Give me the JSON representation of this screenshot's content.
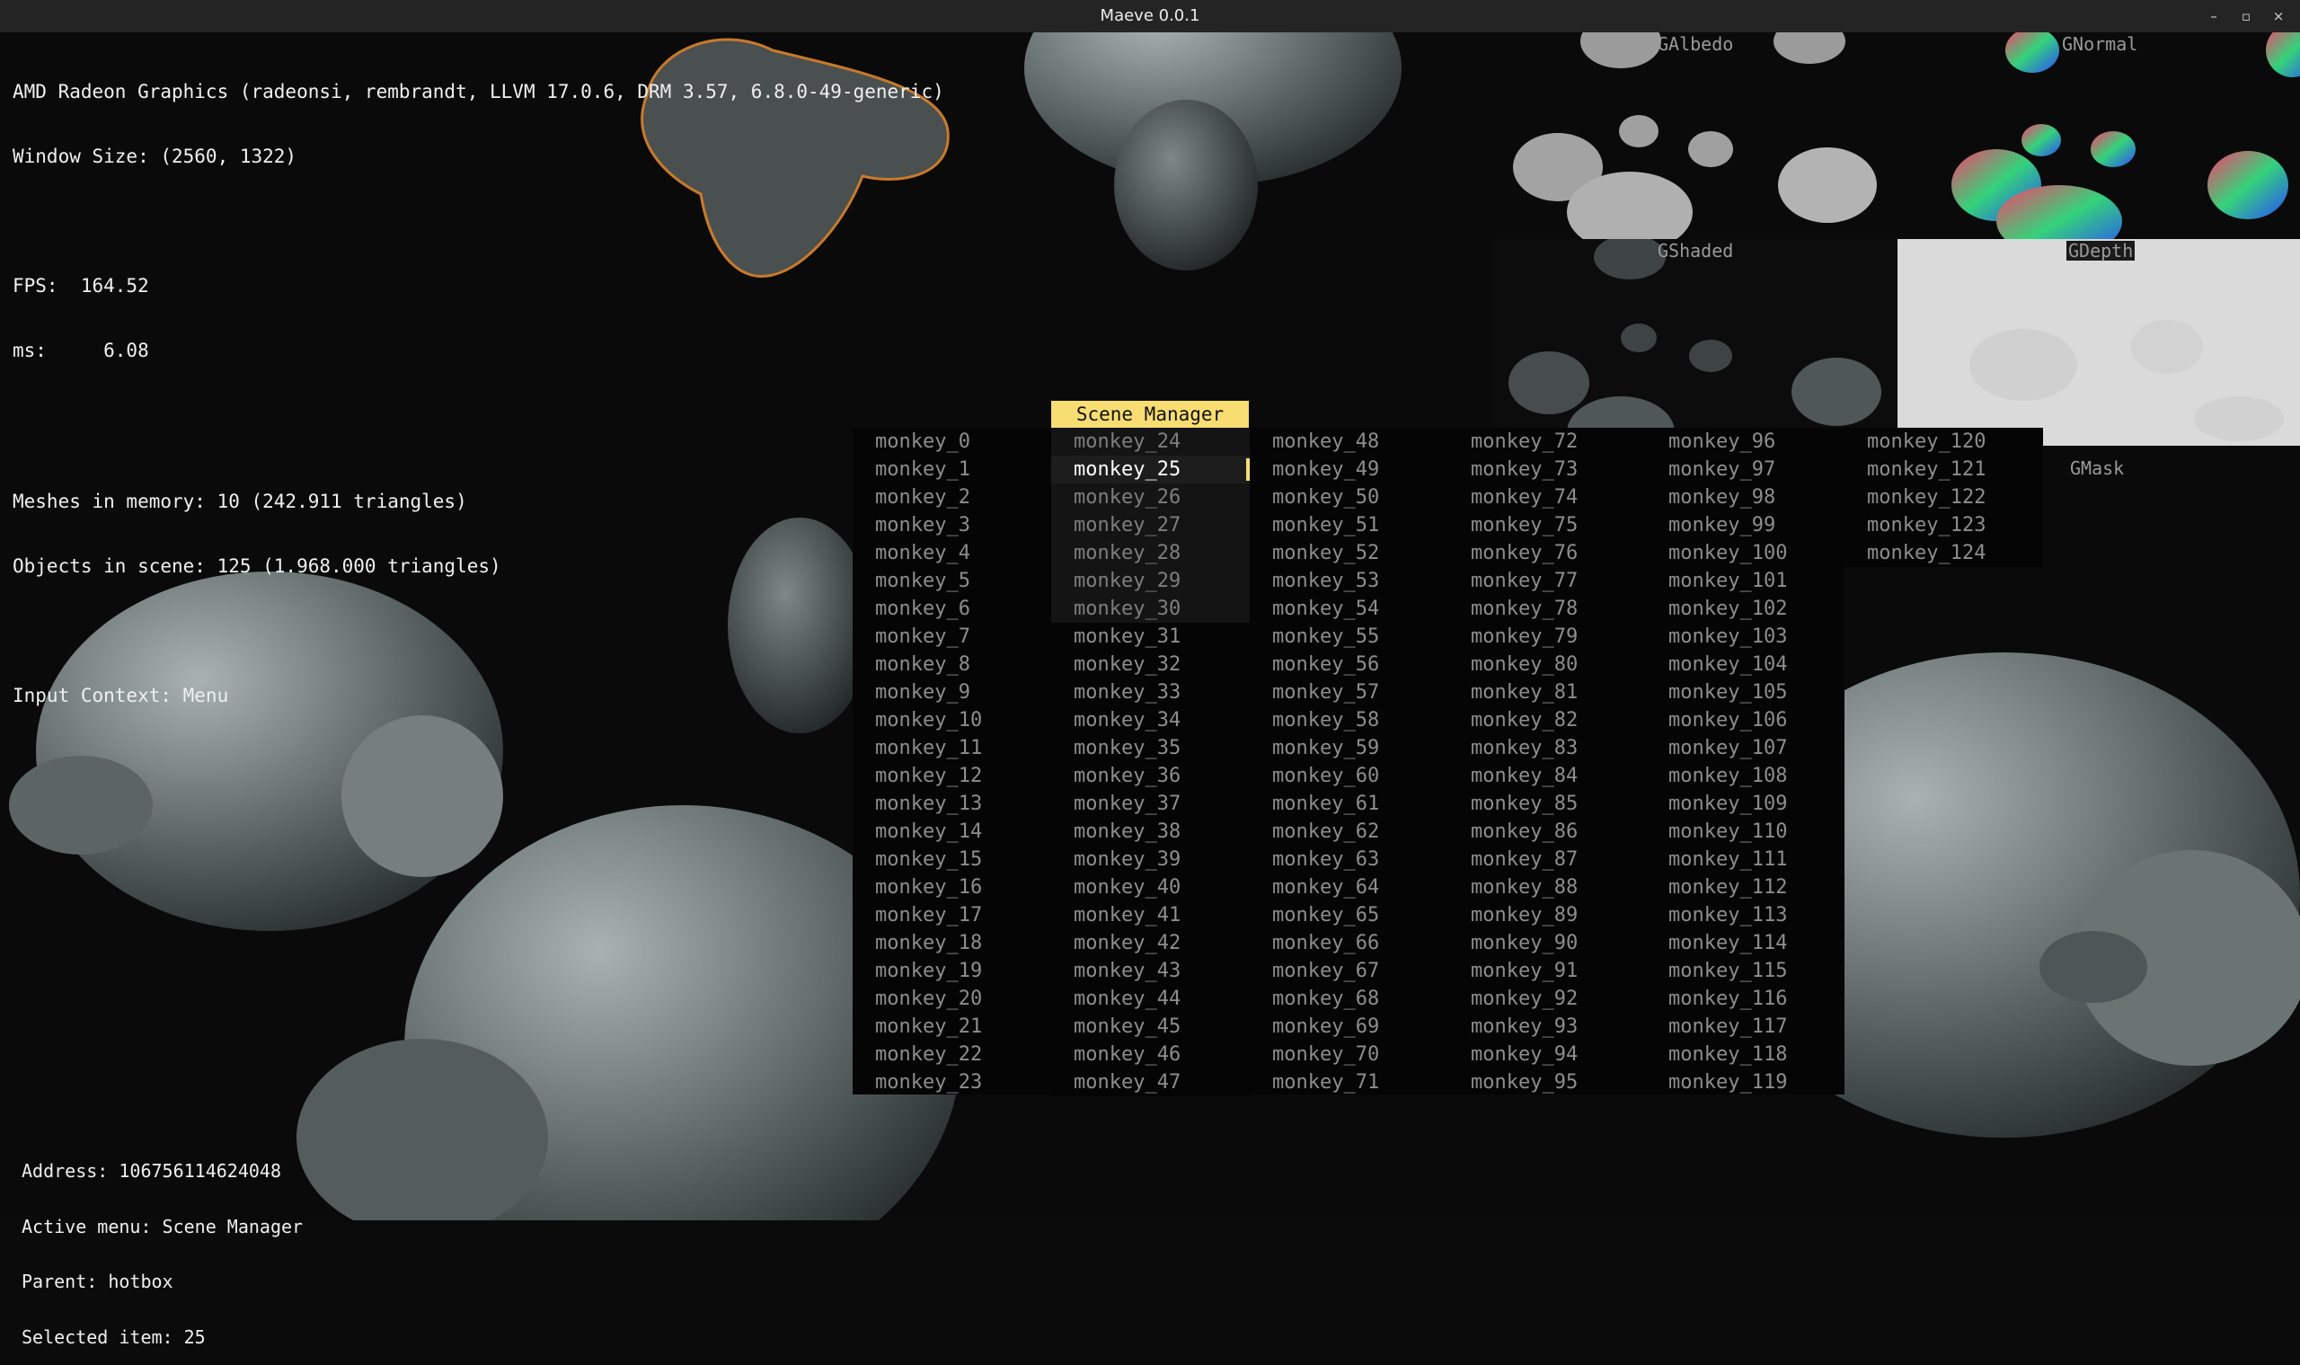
{
  "window": {
    "title": "Maeve 0.0.1",
    "controls": [
      "–",
      "▫",
      "×"
    ]
  },
  "debug": {
    "gpu": "AMD Radeon Graphics (radeonsi, rembrandt, LLVM 17.0.6, DRM 3.57, 6.8.0-49-generic)",
    "window_size": "Window Size: (2560, 1322)",
    "fps": "FPS:  164.52",
    "ms": "ms:     6.08",
    "meshes": "Meshes in memory: 10 (242.911 triangles)",
    "objects": "Objects in scene: 125 (1.968.000 triangles)",
    "input_context": "Input Context: Menu"
  },
  "gbuffer": {
    "albedo": "GAlbedo",
    "normal": "GNormal",
    "shaded": "GShaded",
    "depth": "GDepth",
    "mask": "GMask"
  },
  "menu": {
    "title": "Scene Manager",
    "selected_index": 25,
    "columns": [
      [
        "monkey_0",
        "monkey_1",
        "monkey_2",
        "monkey_3",
        "monkey_4",
        "monkey_5",
        "monkey_6",
        "monkey_7",
        "monkey_8",
        "monkey_9",
        "monkey_10",
        "monkey_11",
        "monkey_12",
        "monkey_13",
        "monkey_14",
        "monkey_15",
        "monkey_16",
        "monkey_17",
        "monkey_18",
        "monkey_19",
        "monkey_20",
        "monkey_21",
        "monkey_22",
        "monkey_23"
      ],
      [
        "monkey_24",
        "monkey_25",
        "monkey_26",
        "monkey_27",
        "monkey_28",
        "monkey_29",
        "monkey_30",
        "monkey_31",
        "monkey_32",
        "monkey_33",
        "monkey_34",
        "monkey_35",
        "monkey_36",
        "monkey_37",
        "monkey_38",
        "monkey_39",
        "monkey_40",
        "monkey_41",
        "monkey_42",
        "monkey_43",
        "monkey_44",
        "monkey_45",
        "monkey_46",
        "monkey_47"
      ],
      [
        "monkey_48",
        "monkey_49",
        "monkey_50",
        "monkey_51",
        "monkey_52",
        "monkey_53",
        "monkey_54",
        "monkey_55",
        "monkey_56",
        "monkey_57",
        "monkey_58",
        "monkey_59",
        "monkey_60",
        "monkey_61",
        "monkey_62",
        "monkey_63",
        "monkey_64",
        "monkey_65",
        "monkey_66",
        "monkey_67",
        "monkey_68",
        "monkey_69",
        "monkey_70",
        "monkey_71"
      ],
      [
        "monkey_72",
        "monkey_73",
        "monkey_74",
        "monkey_75",
        "monkey_76",
        "monkey_77",
        "monkey_78",
        "monkey_79",
        "monkey_80",
        "monkey_81",
        "monkey_82",
        "monkey_83",
        "monkey_84",
        "monkey_85",
        "monkey_86",
        "monkey_87",
        "monkey_88",
        "monkey_89",
        "monkey_90",
        "monkey_91",
        "monkey_92",
        "monkey_93",
        "monkey_94",
        "monkey_95"
      ],
      [
        "monkey_96",
        "monkey_97",
        "monkey_98",
        "monkey_99",
        "monkey_100",
        "monkey_101",
        "monkey_102",
        "monkey_103",
        "monkey_104",
        "monkey_105",
        "monkey_106",
        "monkey_107",
        "monkey_108",
        "monkey_109",
        "monkey_110",
        "monkey_111",
        "monkey_112",
        "monkey_113",
        "monkey_114",
        "monkey_115",
        "monkey_116",
        "monkey_117",
        "monkey_118",
        "monkey_119"
      ],
      [
        "monkey_120",
        "monkey_121",
        "monkey_122",
        "monkey_123",
        "monkey_124"
      ]
    ]
  },
  "status": {
    "address": "Address: 106756114624048",
    "active_menu": "Active menu: Scene Manager",
    "parent": "Parent: hotbox",
    "selected_item": "Selected item: 25"
  },
  "colors": {
    "menu_accent": "#f7dd72",
    "selection_outline": "#c87a2a",
    "model_tint": "#5f6868"
  }
}
